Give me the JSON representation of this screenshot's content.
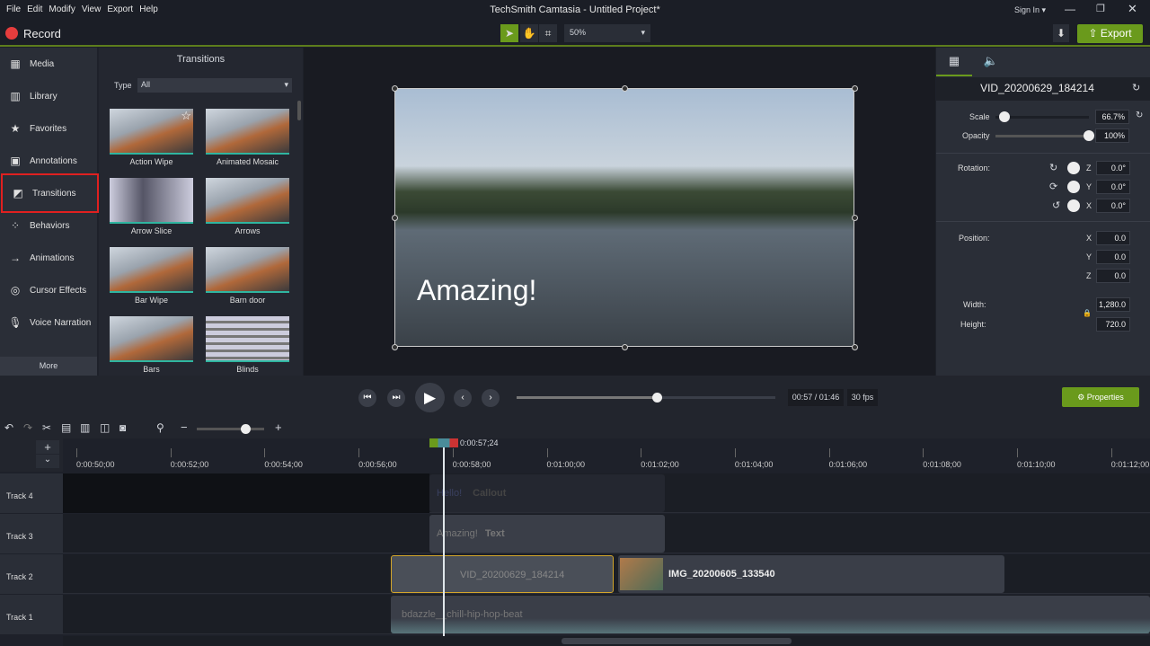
{
  "menu": [
    "File",
    "Edit",
    "Modify",
    "View",
    "Export",
    "Help"
  ],
  "window_title": "TechSmith Camtasia - Untitled Project*",
  "sign_in": "Sign In ▾",
  "record": "Record",
  "zoom": "50%",
  "export": "Export",
  "sidebar": [
    "Media",
    "Library",
    "Favorites",
    "Annotations",
    "Transitions",
    "Behaviors",
    "Animations",
    "Cursor Effects",
    "Voice Narration"
  ],
  "sidebar_more": "More",
  "panel": {
    "title": "Transitions",
    "type_label": "Type",
    "type_value": "All",
    "tiles": [
      "Action Wipe",
      "Animated Mosaic",
      "Arrow Slice",
      "Arrows",
      "Bar Wipe",
      "Barn door",
      "Bars",
      "Blinds"
    ]
  },
  "video_caption": "Amazing!",
  "props": {
    "clip_name": "VID_20200629_184214",
    "scale_label": "Scale",
    "scale": "66.7%",
    "scale_fraction": 0.1,
    "opacity_label": "Opacity",
    "opacity": "100%",
    "rotation_label": "Rotation:",
    "rot": [
      {
        "axis": "Z",
        "v": "0.0°"
      },
      {
        "axis": "Y",
        "v": "0.0°"
      },
      {
        "axis": "X",
        "v": "0.0°"
      }
    ],
    "position_label": "Position:",
    "pos": [
      {
        "axis": "X",
        "v": "0.0"
      },
      {
        "axis": "Y",
        "v": "0.0"
      },
      {
        "axis": "Z",
        "v": "0.0"
      }
    ],
    "width_label": "Width:",
    "width": "1,280.0",
    "height_label": "Height:",
    "height": "720.0"
  },
  "playback": {
    "time": "00:57 / 01:46",
    "fps": "30 fps",
    "progress": 0.54,
    "properties": "Properties"
  },
  "timeline": {
    "playhead": "0:00:57;24",
    "ticks": [
      "0:00:50;00",
      "0:00:52;00",
      "0:00:54;00",
      "0:00:56;00",
      "0:00:58;00",
      "0:01:00;00",
      "0:01:02;00",
      "0:01:04;00",
      "0:01:06;00",
      "0:01:08;00",
      "0:01:10;00",
      "0:01:12;00"
    ],
    "tracks": [
      "Track 4",
      "Track 3",
      "Track 2",
      "Track 1"
    ],
    "clips": {
      "callout_text": "Hello!",
      "callout": "Callout",
      "text_text": "Amazing!",
      "text": "Text",
      "video": "VID_20200629_184214",
      "image": "IMG_20200605_133540",
      "audio": "bdazzle__chill-hip-hop-beat"
    }
  }
}
